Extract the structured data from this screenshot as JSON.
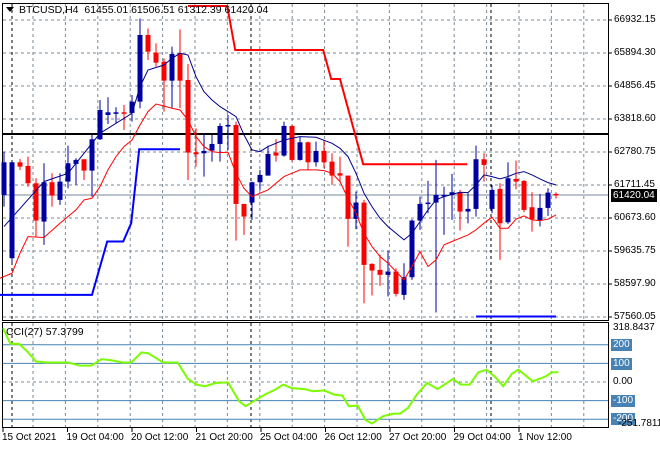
{
  "header": {
    "symbol": "BTCUSD,H4",
    "open": "61455.01",
    "high": "61506.51",
    "low": "61312.39",
    "close": "61420.04"
  },
  "cci_header": {
    "name": "CCI(27)",
    "value": "57.3799"
  },
  "price_axis": [
    "66932.15",
    "65894.30",
    "64856.45",
    "63818.60",
    "62780.75",
    "61711.45",
    "60673.60",
    "59635.75",
    "58597.90",
    "57560.05"
  ],
  "current_price_label": "61420.04",
  "cci_axis": {
    "max": "318.8437",
    "l200": "200",
    "l100": "100",
    "zero": "0.00",
    "lm100": "-100",
    "lm200": "-200",
    "min": "-251.7811"
  },
  "x_axis": [
    "15 Oct 2021",
    "19 Oct 04:00",
    "20 Oct 12:00",
    "21 Oct 20:00",
    "25 Oct 04:00",
    "26 Oct 12:00",
    "27 Oct 20:00",
    "29 Oct 04:00",
    "1 Nov 12:00"
  ],
  "colors": {
    "bull": "#0000a0",
    "bear": "#ff0000",
    "ma_upper": "#00008b",
    "ma_lower": "#ff0000",
    "resistance": "#ff0000",
    "support": "#0000ff",
    "cci": "#7cfc00",
    "level": "#4682b4"
  },
  "chart_data": [
    {
      "type": "candlestick",
      "title": "BTCUSD,H4",
      "ylim": [
        57560.05,
        66932.15
      ],
      "ohlc": [
        [
          61424,
          62788,
          61057,
          62452
        ],
        [
          59431,
          62460,
          59274,
          62452
        ],
        [
          62452,
          62557,
          62211,
          62316
        ],
        [
          62337,
          62631,
          61687,
          61791
        ],
        [
          61791,
          61949,
          60113,
          60617
        ],
        [
          60585,
          62421,
          59851,
          61823
        ],
        [
          61823,
          62106,
          61057,
          61403
        ],
        [
          61267,
          62106,
          61110,
          61844
        ],
        [
          61844,
          62977,
          61634,
          62421
        ],
        [
          62400,
          62578,
          61739,
          62526
        ],
        [
          62547,
          62547,
          61896,
          62190
        ],
        [
          62190,
          63313,
          61372,
          63176
        ],
        [
          63176,
          64414,
          63155,
          64099
        ],
        [
          63942,
          64498,
          63659,
          64026
        ],
        [
          64005,
          64183,
          63680,
          64026
        ],
        [
          64026,
          64257,
          63470,
          64005
        ],
        [
          64005,
          64571,
          63732,
          64362
        ],
        [
          64362,
          66984,
          64152,
          66460
        ],
        [
          66460,
          66669,
          65673,
          65935
        ],
        [
          65904,
          66197,
          65463,
          65589
        ],
        [
          65620,
          65725,
          64047,
          65022
        ],
        [
          65022,
          66092,
          64152,
          65862
        ],
        [
          65883,
          66638,
          64152,
          65022
        ],
        [
          65043,
          65547,
          61896,
          62757
        ],
        [
          62767,
          63522,
          62316,
          62704
        ],
        [
          62736,
          63365,
          62001,
          62809
        ],
        [
          62820,
          63313,
          62473,
          63029
        ],
        [
          63029,
          63680,
          62473,
          63596
        ],
        [
          63596,
          63942,
          62841,
          63627
        ],
        [
          63627,
          63732,
          59987,
          61141
        ],
        [
          61141,
          61141,
          60166,
          60742
        ],
        [
          61183,
          61844,
          60638,
          61823
        ],
        [
          61823,
          62211,
          61582,
          62054
        ],
        [
          62033,
          62977,
          62033,
          62715
        ],
        [
          62757,
          63176,
          62473,
          62662
        ],
        [
          62662,
          63732,
          62631,
          63596
        ],
        [
          63596,
          63627,
          62473,
          62526
        ],
        [
          62526,
          63260,
          62505,
          63082
        ],
        [
          63082,
          63103,
          62211,
          62452
        ],
        [
          62452,
          63103,
          62316,
          62809
        ],
        [
          62809,
          63155,
          62264,
          62452
        ],
        [
          62473,
          62736,
          61739,
          62033
        ],
        [
          62106,
          62631,
          61844,
          62033
        ],
        [
          62033,
          62033,
          59798,
          60669
        ],
        [
          60669,
          61529,
          60344,
          61183
        ],
        [
          61183,
          61267,
          58015,
          59221
        ],
        [
          59253,
          59274,
          58256,
          59043
        ],
        [
          59064,
          59536,
          58561,
          58907
        ],
        [
          58907,
          59672,
          58225,
          59012
        ],
        [
          59012,
          59117,
          58225,
          58309
        ],
        [
          58277,
          59274,
          58120,
          58833
        ],
        [
          58833,
          60659,
          58749,
          60617
        ],
        [
          60617,
          61372,
          60323,
          61141
        ],
        [
          61141,
          61865,
          60847,
          61183
        ],
        [
          61183,
          62526,
          57721,
          61424
        ],
        [
          61393,
          61687,
          60166,
          61424
        ],
        [
          61424,
          62085,
          60638,
          61508
        ],
        [
          61508,
          61582,
          60302,
          60900
        ],
        [
          60900,
          61477,
          60533,
          60984
        ],
        [
          60984,
          62977,
          60742,
          62547
        ],
        [
          62547,
          62736,
          61844,
          62368
        ],
        [
          60984,
          61739,
          60847,
          61582
        ],
        [
          61613,
          61791,
          59379,
          60533
        ],
        [
          60564,
          62452,
          60512,
          61949
        ],
        [
          61928,
          62505,
          61603,
          61844
        ],
        [
          61865,
          61896,
          60879,
          60952
        ],
        [
          61036,
          61508,
          60270,
          60659
        ],
        [
          60617,
          61456,
          60428,
          61015
        ],
        [
          61015,
          61634,
          60763,
          61498
        ],
        [
          61455,
          61506,
          61312,
          61420
        ]
      ],
      "ma_upper": [
        [
          1,
          60428
        ],
        [
          6,
          61844
        ],
        [
          9,
          62106
        ],
        [
          13,
          63365
        ],
        [
          17,
          63994
        ],
        [
          18,
          64834
        ],
        [
          19,
          65358
        ],
        [
          21,
          65516
        ],
        [
          22,
          65725
        ],
        [
          23,
          65883
        ],
        [
          24,
          65830
        ],
        [
          25,
          65148
        ],
        [
          26,
          64676
        ],
        [
          27,
          64414
        ],
        [
          28,
          64204
        ],
        [
          29,
          64047
        ],
        [
          30,
          63889
        ],
        [
          31,
          63313
        ],
        [
          32,
          62841
        ],
        [
          33,
          62788
        ],
        [
          34,
          62945
        ],
        [
          36,
          63155
        ],
        [
          38,
          63260
        ],
        [
          40,
          63239
        ],
        [
          42,
          63050
        ],
        [
          43,
          62893
        ],
        [
          44,
          62631
        ],
        [
          45,
          62106
        ],
        [
          46,
          61477
        ],
        [
          47,
          61057
        ],
        [
          48,
          60690
        ],
        [
          49,
          60428
        ],
        [
          51,
          60008
        ],
        [
          52,
          60218
        ],
        [
          53,
          60585
        ],
        [
          54,
          60952
        ],
        [
          55,
          61267
        ],
        [
          56,
          61372
        ],
        [
          58,
          61508
        ],
        [
          59,
          61498
        ],
        [
          60,
          61739
        ],
        [
          61,
          62054
        ],
        [
          62,
          62001
        ],
        [
          63,
          61928
        ],
        [
          64,
          62001
        ],
        [
          65,
          62106
        ],
        [
          66,
          62159
        ],
        [
          67,
          62054
        ],
        [
          68,
          61928
        ],
        [
          69,
          61813
        ],
        [
          70,
          61739
        ]
      ],
      "ma_lower": [
        [
          0.5,
          58802
        ],
        [
          2,
          58959
        ],
        [
          3,
          59589
        ],
        [
          4,
          60113
        ],
        [
          6,
          60082
        ],
        [
          8,
          60533
        ],
        [
          10,
          60952
        ],
        [
          11,
          61267
        ],
        [
          12,
          61319
        ],
        [
          13,
          61687
        ],
        [
          14,
          62211
        ],
        [
          15,
          62631
        ],
        [
          16,
          62945
        ],
        [
          17,
          63155
        ],
        [
          18,
          63627
        ],
        [
          19,
          64047
        ],
        [
          20,
          64288
        ],
        [
          21,
          64225
        ],
        [
          22,
          64152
        ],
        [
          23,
          64099
        ],
        [
          24,
          63785
        ],
        [
          25,
          63260
        ],
        [
          26,
          62945
        ],
        [
          27,
          62788
        ],
        [
          28,
          62757
        ],
        [
          29,
          62767
        ],
        [
          30,
          62106
        ],
        [
          31,
          61634
        ],
        [
          32,
          61372
        ],
        [
          33,
          61477
        ],
        [
          34,
          61582
        ],
        [
          35,
          61791
        ],
        [
          36,
          62001
        ],
        [
          37,
          62106
        ],
        [
          38,
          62211
        ],
        [
          40,
          62211
        ],
        [
          41,
          62190
        ],
        [
          42,
          62106
        ],
        [
          43,
          61844
        ],
        [
          44,
          61319
        ],
        [
          45,
          60847
        ],
        [
          46,
          60218
        ],
        [
          47,
          59798
        ],
        [
          48,
          59484
        ],
        [
          49,
          59274
        ],
        [
          50,
          59012
        ],
        [
          51,
          58749
        ],
        [
          52,
          59169
        ],
        [
          53,
          59640
        ],
        [
          54,
          59169
        ],
        [
          55,
          59379
        ],
        [
          56,
          59851
        ],
        [
          57,
          59956
        ],
        [
          58,
          60061
        ],
        [
          59,
          60166
        ],
        [
          60,
          60323
        ],
        [
          61,
          60533
        ],
        [
          62,
          60722
        ],
        [
          63,
          60375
        ],
        [
          64,
          60375
        ],
        [
          65,
          60659
        ],
        [
          66,
          60764
        ],
        [
          67,
          60638
        ],
        [
          68,
          60617
        ],
        [
          69,
          60659
        ],
        [
          70,
          60795
        ]
      ],
      "resistance_line": [
        [
          24,
          67372
        ],
        [
          28.9,
          67372
        ],
        [
          29.9,
          65988
        ],
        [
          40.9,
          65988
        ],
        [
          41.9,
          65075
        ],
        [
          43,
          65075
        ],
        [
          45.9,
          62390
        ],
        [
          58.9,
          62390
        ]
      ],
      "support_line": [
        [
          0.5,
          58277
        ],
        [
          12,
          58277
        ],
        [
          13.9,
          59956
        ],
        [
          15.9,
          59956
        ],
        [
          16.9,
          60533
        ],
        [
          17.9,
          62862
        ],
        [
          23,
          62862
        ]
      ],
      "support_line_2": [
        [
          60,
          57596
        ],
        [
          70,
          57596
        ]
      ],
      "horizontal_level": 63344,
      "current_price": 61420.04
    },
    {
      "type": "line",
      "title": "CCI(27) 57.3799",
      "ylim": [
        -251.7811,
        318.8437
      ],
      "levels": [
        200,
        100,
        0,
        -100,
        -200
      ],
      "points": [
        [
          0.9,
          289
        ],
        [
          1.8,
          205
        ],
        [
          2.9,
          205
        ],
        [
          3.9,
          164
        ],
        [
          5,
          111
        ],
        [
          6.3,
          105
        ],
        [
          9,
          105
        ],
        [
          10.5,
          88
        ],
        [
          11.9,
          88
        ],
        [
          13.2,
          123
        ],
        [
          14.5,
          116
        ],
        [
          15.8,
          105
        ],
        [
          16.9,
          105
        ],
        [
          18.2,
          159
        ],
        [
          19,
          155
        ],
        [
          20.9,
          105
        ],
        [
          22.7,
          105
        ],
        [
          24,
          16
        ],
        [
          25.1,
          -14
        ],
        [
          26.1,
          -23
        ],
        [
          27.5,
          -5
        ],
        [
          29,
          -2
        ],
        [
          30.4,
          -104
        ],
        [
          31.2,
          -130
        ],
        [
          32.2,
          -104
        ],
        [
          33.6,
          -68
        ],
        [
          34.9,
          -41
        ],
        [
          35.9,
          -14
        ],
        [
          37,
          -34
        ],
        [
          38.6,
          -38
        ],
        [
          39.6,
          -50
        ],
        [
          41,
          -45
        ],
        [
          42.3,
          -68
        ],
        [
          43.3,
          -73
        ],
        [
          44.1,
          -130
        ],
        [
          45.2,
          -127
        ],
        [
          46.2,
          -205
        ],
        [
          47,
          -223
        ],
        [
          48.4,
          -184
        ],
        [
          49.7,
          -170
        ],
        [
          50.5,
          -170
        ],
        [
          51.5,
          -139
        ],
        [
          52.6,
          -68
        ],
        [
          53.9,
          -5
        ],
        [
          55.2,
          -38
        ],
        [
          57.1,
          16
        ],
        [
          58.1,
          -14
        ],
        [
          59.2,
          -14
        ],
        [
          60.3,
          52
        ],
        [
          61.3,
          66
        ],
        [
          62.4,
          27
        ],
        [
          63.4,
          -23
        ],
        [
          64.5,
          45
        ],
        [
          65.3,
          66
        ],
        [
          67.1,
          4
        ],
        [
          68.7,
          30
        ],
        [
          69.5,
          52
        ],
        [
          70.3,
          52
        ]
      ]
    }
  ]
}
